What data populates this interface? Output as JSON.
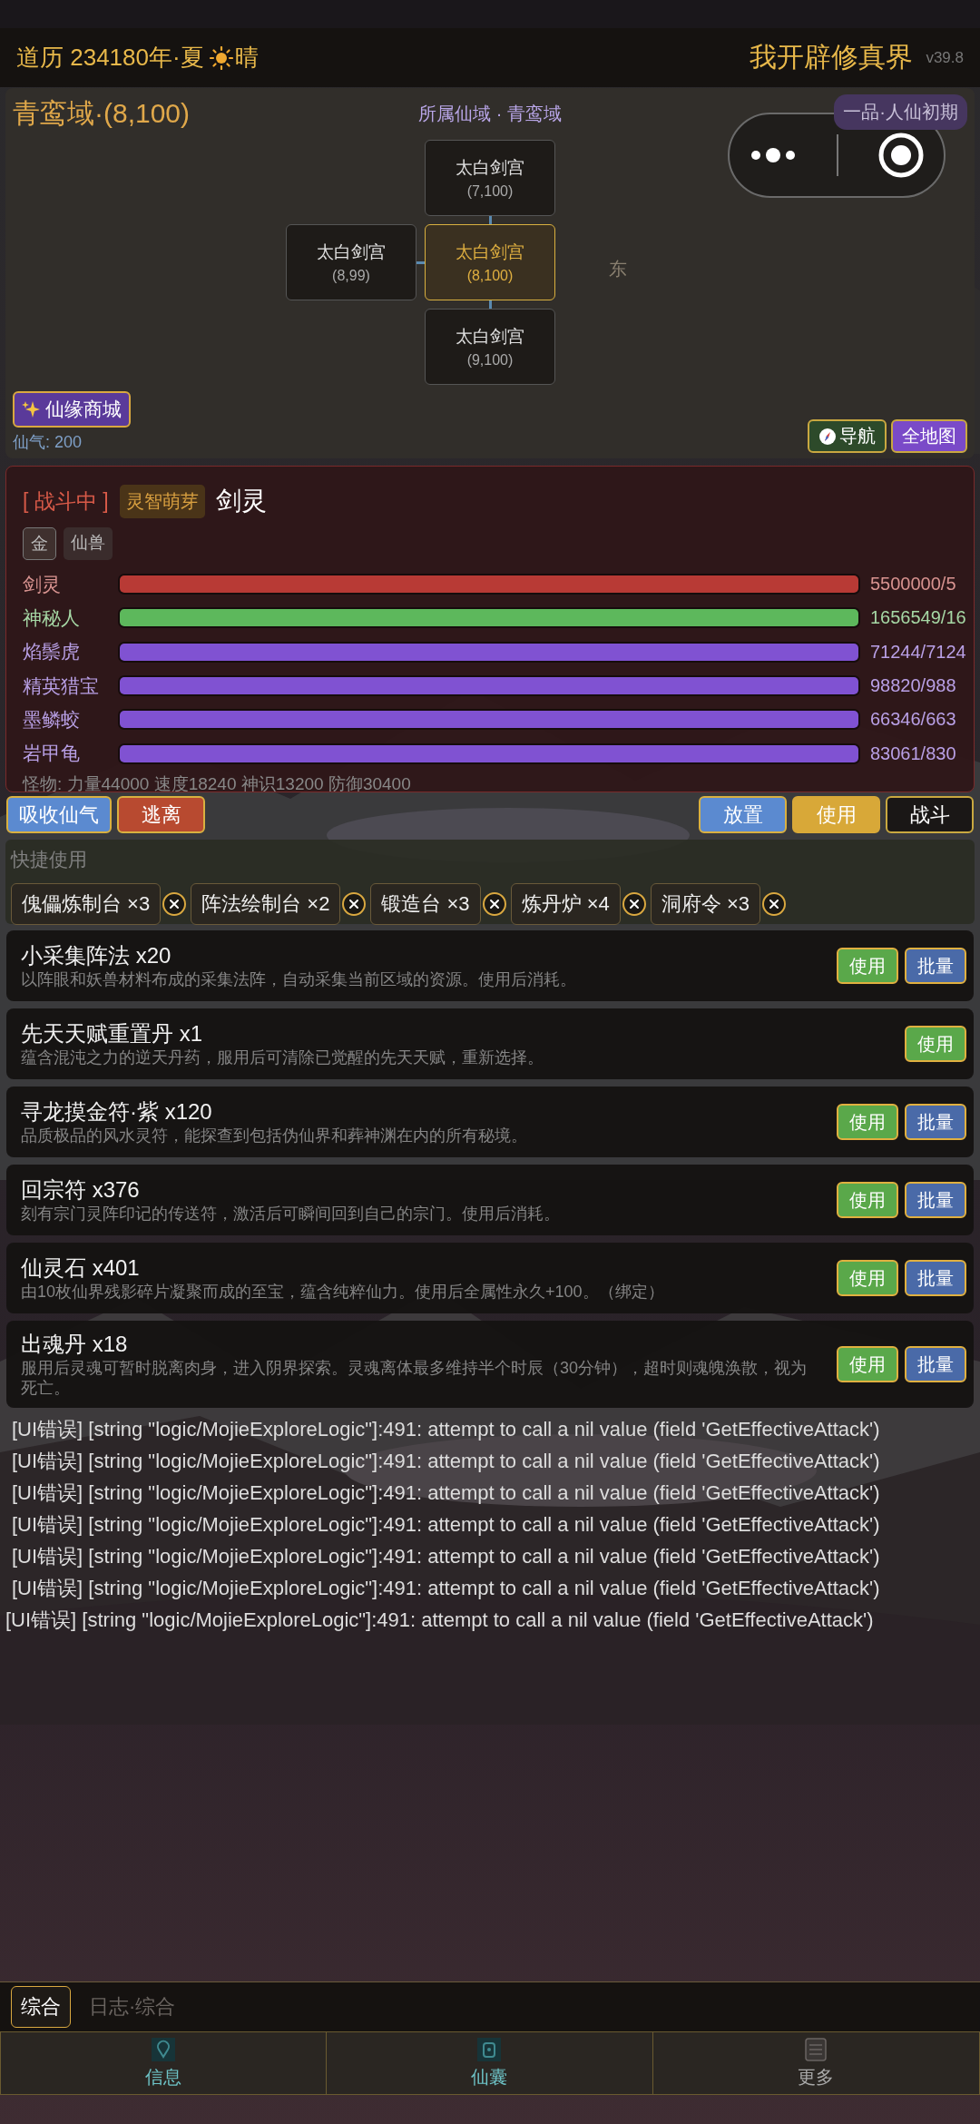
{
  "header": {
    "calendar": "道历 234180年·夏",
    "weather": "晴",
    "title": "我开辟修真界",
    "version": "v39.8"
  },
  "map": {
    "title": "青鸾域·(8,100)",
    "region": "所属仙域 · 青鸾域",
    "realm_badge": "一品·人仙初期",
    "compass_label": "东",
    "nodes": [
      {
        "name": "太白剑宫",
        "coords": "(7,100)",
        "selected": false
      },
      {
        "name": "太白剑宫",
        "coords": "(8,99)",
        "selected": false
      },
      {
        "name": "太白剑宫",
        "coords": "(8,100)",
        "selected": true
      },
      {
        "name": "太白剑宫",
        "coords": "(9,100)",
        "selected": false
      }
    ],
    "shop_button": "仙缘商城",
    "qi": "仙气: 200",
    "nav_buttons": [
      {
        "label": "导航",
        "kind": "navigate"
      },
      {
        "label": "全地图",
        "kind": "map"
      }
    ]
  },
  "battle": {
    "status": "[ 战斗中 ]",
    "rank": "灵智萌芽",
    "name": "剑灵",
    "tags": [
      {
        "label": "金",
        "kind": "outlined"
      },
      {
        "label": "仙兽",
        "kind": "plain"
      }
    ],
    "combatants": [
      {
        "name": "剑灵",
        "level": 1,
        "reading": "5500000/5",
        "color": "#b83a35"
      },
      {
        "name": "神秘人",
        "level": 1,
        "reading": "1656549/16",
        "color": "#5db85c"
      },
      {
        "name": "焰鬃虎",
        "level": 1,
        "reading": "71244/7124",
        "color": "#8052d2"
      },
      {
        "name": "精英猎宝",
        "level": 1,
        "reading": "98820/988",
        "color": "#8052d2"
      },
      {
        "name": "墨鳞蛟",
        "level": 1,
        "reading": "66346/663",
        "color": "#8052d2"
      },
      {
        "name": "岩甲龟",
        "level": 1,
        "reading": "83061/830",
        "color": "#8052d2"
      }
    ],
    "stats": "怪物: 力量44000 速度18240 神识13200 防御30400"
  },
  "actions_left": [
    {
      "label": "吸收仙气",
      "kind": "blue"
    },
    {
      "label": "逃离",
      "kind": "red"
    }
  ],
  "actions_right": [
    {
      "label": "放置",
      "kind": "blue"
    },
    {
      "label": "使用",
      "kind": "gold"
    },
    {
      "label": "战斗",
      "kind": "dark"
    }
  ],
  "quick_use": {
    "label": "快捷使用",
    "items": [
      "傀儡炼制台 ×3",
      "阵法绘制台 ×2",
      "锻造台 ×3",
      "炼丹炉 ×4",
      "洞府令 ×3"
    ]
  },
  "items": [
    {
      "name": "小采集阵法 x20",
      "description": "以阵眼和妖兽材料布成的采集法阵，自动采集当前区域的资源。使用后消耗。",
      "buttons": [
        {
          "label": "使用",
          "kind": "use"
        },
        {
          "label": "批量",
          "kind": "batch"
        }
      ]
    },
    {
      "name": "先天天赋重置丹 x1",
      "description": "蕴含混沌之力的逆天丹药，服用后可清除已觉醒的先天天赋，重新选择。",
      "buttons": [
        {
          "label": "使用",
          "kind": "use"
        }
      ]
    },
    {
      "name": "寻龙摸金符·紫 x120",
      "description": "品质极品的风水灵符，能探查到包括伪仙界和葬神渊在内的所有秘境。",
      "buttons": [
        {
          "label": "使用",
          "kind": "use"
        },
        {
          "label": "批量",
          "kind": "batch"
        }
      ]
    },
    {
      "name": "回宗符 x376",
      "description": "刻有宗门灵阵印记的传送符，激活后可瞬间回到自己的宗门。使用后消耗。",
      "buttons": [
        {
          "label": "使用",
          "kind": "use"
        },
        {
          "label": "批量",
          "kind": "batch"
        }
      ]
    },
    {
      "name": "仙灵石 x401",
      "description": "由10枚仙界残影碎片凝聚而成的至宝，蕴含纯粹仙力。使用后全属性永久+100。（绑定）",
      "buttons": [
        {
          "label": "使用",
          "kind": "use"
        },
        {
          "label": "批量",
          "kind": "batch"
        }
      ]
    },
    {
      "name": "出魂丹 x18",
      "description": "服用后灵魂可暂时脱离肉身，进入阴界探索。灵魂离体最多维持半个时辰（30分钟），超时则魂魄涣散，视为死亡。",
      "buttons": [
        {
          "label": "使用",
          "kind": "use"
        },
        {
          "label": "批量",
          "kind": "batch"
        }
      ]
    }
  ],
  "log": [
    {
      "text": "[UI错误] [string \"logic/MojieExploreLogic\"]:491: attempt to call a nil value (field 'GetEffectiveAttack')",
      "indented": true
    },
    {
      "text": "[UI错误] [string \"logic/MojieExploreLogic\"]:491: attempt to call a nil value (field 'GetEffectiveAttack')",
      "indented": true
    },
    {
      "text": "[UI错误] [string \"logic/MojieExploreLogic\"]:491: attempt to call a nil value (field 'GetEffectiveAttack')",
      "indented": true
    },
    {
      "text": "[UI错误] [string \"logic/MojieExploreLogic\"]:491: attempt to call a nil value (field 'GetEffectiveAttack')",
      "indented": true
    },
    {
      "text": "[UI错误] [string \"logic/MojieExploreLogic\"]:491: attempt to call a nil value (field 'GetEffectiveAttack')",
      "indented": true
    },
    {
      "text": "[UI错误] [string \"logic/MojieExploreLogic\"]:491: attempt to call a nil value (field 'GetEffectiveAttack')",
      "indented": true
    },
    {
      "text": "[UI错误] [string \"logic/MojieExploreLogic\"]:491: attempt to call a nil value (field 'GetEffectiveAttack')",
      "indented": false
    }
  ],
  "bottom_tabs": [
    {
      "label": "综合",
      "selected": true
    }
  ],
  "log_title": "日志·综合",
  "nav": [
    {
      "label": "信息",
      "color": "#6ec4c8"
    },
    {
      "label": "仙囊",
      "color": "#6ec4c8"
    },
    {
      "label": "更多",
      "color": "#a8a8a8"
    }
  ]
}
